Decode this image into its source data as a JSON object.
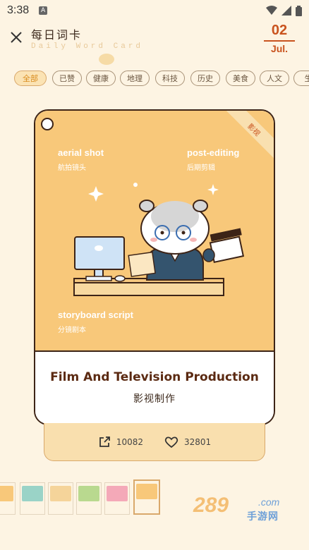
{
  "status": {
    "time": "3:38",
    "notification_icon": "A"
  },
  "header": {
    "title": "每日词卡",
    "subtitle": "Daily Word Card",
    "date_day": "02",
    "date_month": "Jul."
  },
  "tabs": [
    {
      "label": "全部",
      "active": true
    },
    {
      "label": "已赞"
    },
    {
      "label": "健康"
    },
    {
      "label": "地理"
    },
    {
      "label": "科技"
    },
    {
      "label": "历史"
    },
    {
      "label": "美食"
    },
    {
      "label": "人文"
    },
    {
      "label": "生"
    }
  ],
  "card": {
    "ribbon": "影视",
    "words": [
      {
        "en": "aerial shot",
        "cn": "航拍镜头"
      },
      {
        "en": "post-editing",
        "cn": "后期剪辑"
      },
      {
        "en": "storyboard script",
        "cn": "分镜剧本"
      }
    ],
    "title_en": "Film And Television Production",
    "title_cn": "影视制作"
  },
  "stats": {
    "shares": "10082",
    "likes": "32801"
  },
  "thumbnails": [
    {
      "color": "#f8c87a"
    },
    {
      "color": "#9ad3c7"
    },
    {
      "color": "#f5d49a"
    },
    {
      "color": "#b9d98f"
    },
    {
      "color": "#f4a9b8"
    },
    {
      "color": "#f8c87a",
      "selected": true
    }
  ],
  "watermark": {
    "brand": "289",
    "domain": ".com",
    "cn": "手游网"
  },
  "colors": {
    "accent": "#c9531e",
    "card_bg": "#f8c87a",
    "page_bg": "#fdf4e3"
  }
}
